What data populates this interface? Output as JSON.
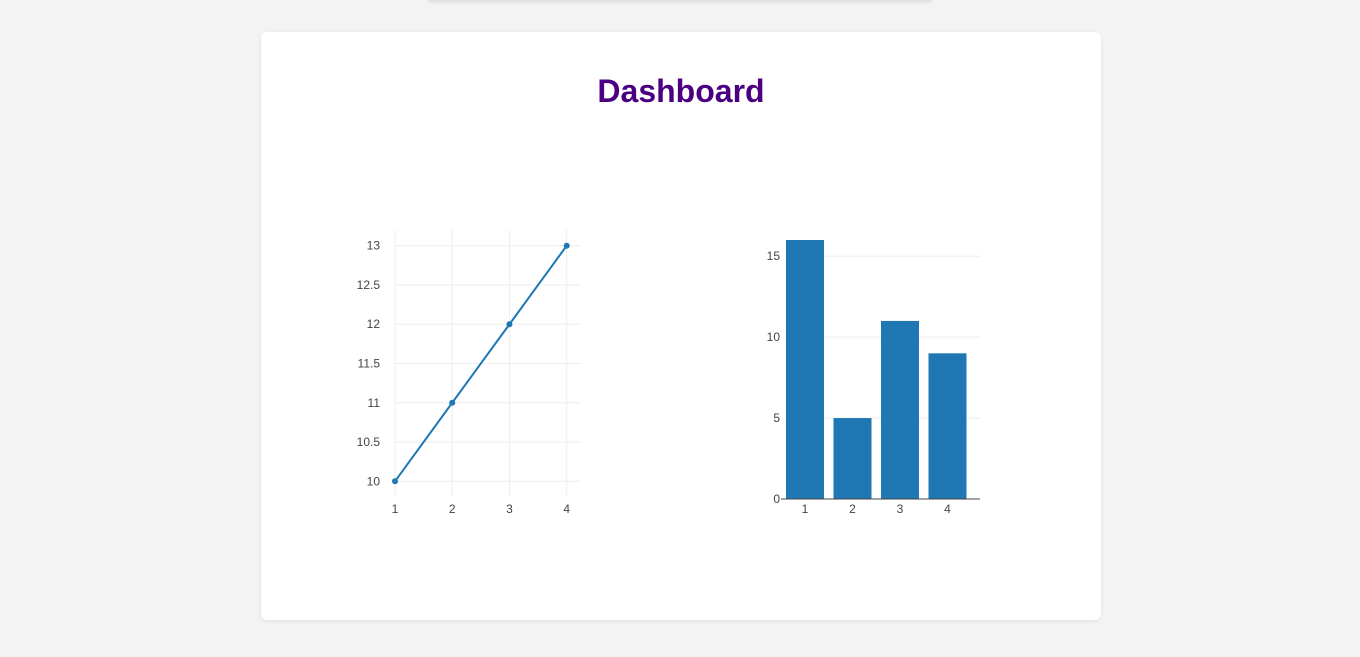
{
  "header": {
    "title": "Dashboard"
  },
  "chart_data": [
    {
      "type": "line",
      "x": [
        1,
        2,
        3,
        4
      ],
      "series": [
        {
          "values": [
            10,
            11,
            12,
            13
          ]
        }
      ],
      "x_ticks": [
        "1",
        "2",
        "3",
        "4"
      ],
      "y_ticks": [
        "10",
        "10.5",
        "11",
        "11.5",
        "12",
        "12.5",
        "13"
      ],
      "xlim": [
        1,
        4.25
      ],
      "ylim": [
        9.8,
        13.2
      ],
      "markers": true,
      "grid": true,
      "color": "#1f77b4"
    },
    {
      "type": "bar",
      "categories": [
        "1",
        "2",
        "3",
        "4"
      ],
      "values": [
        16,
        5,
        11,
        9
      ],
      "y_ticks": [
        "0",
        "5",
        "10",
        "15"
      ],
      "ylim": [
        0,
        16
      ],
      "grid": true,
      "color": "#1f77b4"
    }
  ]
}
